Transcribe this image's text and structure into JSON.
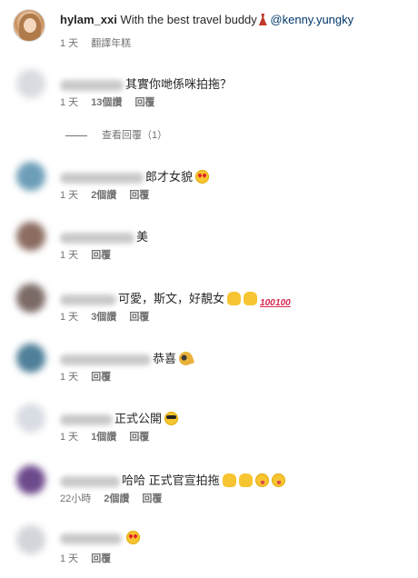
{
  "caption": {
    "username": "hylam_xxi",
    "text": " With the best travel buddy",
    "mention": "@kenny.yungky",
    "time": "1 天",
    "translate": "翻譯年糕"
  },
  "replies_link": "查看回覆（1）",
  "comments": [
    {
      "text": "其實你哋係咪拍拖？",
      "time": "1 天",
      "likes": "13個讚",
      "reply": "回覆",
      "emojis": [],
      "avatar_color": "#d9dbe0",
      "name_width": 70
    },
    {
      "text": "郎才女貌",
      "time": "1 天",
      "likes": "2個讚",
      "reply": "回覆",
      "emojis": [
        "heart-eyes"
      ],
      "avatar_color": "#6d9eb8",
      "name_width": 92
    },
    {
      "text": "美",
      "time": "1 天",
      "likes": "",
      "reply": "回覆",
      "emojis": [],
      "avatar_color": "#8b6c60",
      "name_width": 82
    },
    {
      "text": "可愛，斯文，好靚女",
      "time": "1 天",
      "likes": "3個讚",
      "reply": "回覆",
      "emojis": [
        "thumbs",
        "thumbs",
        "100",
        "100"
      ],
      "avatar_color": "#7b6a66",
      "name_width": 62
    },
    {
      "text": "恭喜",
      "time": "1 天",
      "likes": "",
      "reply": "回覆",
      "emojis": [
        "party"
      ],
      "avatar_color": "#4f7f99",
      "name_width": 100
    },
    {
      "text": "正式公開",
      "time": "1 天",
      "likes": "1個讚",
      "reply": "回覆",
      "emojis": [
        "cool"
      ],
      "avatar_color": "#d8dce3",
      "name_width": 58
    },
    {
      "text": "哈哈 正式官宣拍拖",
      "time": "22小時",
      "likes": "2個讚",
      "reply": "回覆",
      "emojis": [
        "clap",
        "clap",
        "tongue",
        "tongue"
      ],
      "avatar_color": "#6d4a8c",
      "name_width": 66
    },
    {
      "text": "",
      "time": "1 天",
      "likes": "",
      "reply": "回覆",
      "emojis": [
        "heart-eyes"
      ],
      "avatar_color": "#d3d5da",
      "name_width": 68
    }
  ]
}
